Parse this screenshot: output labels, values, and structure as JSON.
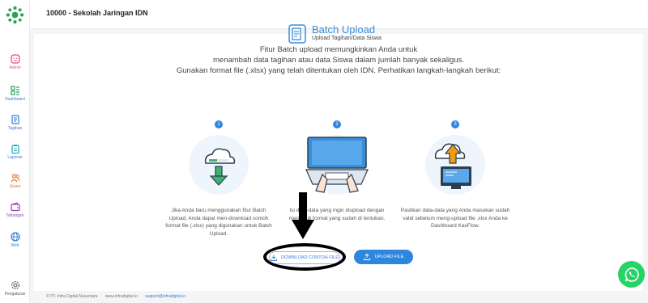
{
  "header": {
    "title": "10000 - Sekolah Jaringan IDN"
  },
  "sidebar": {
    "items": [
      {
        "label": "Admin",
        "icon": "admin-face-icon"
      },
      {
        "label": "Dashboard",
        "icon": "dashboard-icon"
      },
      {
        "label": "Tagihan",
        "icon": "bill-icon"
      },
      {
        "label": "Laporan",
        "icon": "report-clipboard-icon"
      },
      {
        "label": "Siswa",
        "icon": "students-icon"
      },
      {
        "label": "Tabungan",
        "icon": "wallet-icon"
      },
      {
        "label": "Web",
        "icon": "globe-icon"
      }
    ],
    "settings_label": "Pengaturan"
  },
  "main": {
    "title": "Batch Upload",
    "subtitle": "Upload Tagihan/Data Siswa",
    "intro_line1": "Fitur Batch upload memungkinkan Anda untuk",
    "intro_line2": "menambah data tagihan atau data Siswa dalam jumlah banyak sekaligus.",
    "intro_line3": "Gunakan format file (.xlsx) yang telah ditentukan oleh IDN. Perhatikan langkah-langkah berikut:",
    "steps": [
      {
        "number": "1",
        "text": "Jika Anda baru menggunakan fitur Batch Upload, Anda dapat men-download contoh format file (.xlsx) yang digunakan untuk Batch Upload."
      },
      {
        "number": "2",
        "text": "Isi data-data yang ingin diupload dengan mengikuti format yang sudah di tentukan."
      },
      {
        "number": "3",
        "text": "Pastikan data-data yang Anda masukan sudah valid sebelum meng-upload file .xlsx Anda ke Dashboard KasFlow."
      }
    ],
    "download_label": "DOWNLOAD CONTOH FILE",
    "upload_label": "UPLOAD FILE"
  },
  "footer": {
    "copyright": "© PT. Infra Digital Nusantara",
    "website": "www.infradigital.io",
    "email": "support@infradigital.io"
  },
  "colors": {
    "accent": "#2e86de",
    "brand_green": "#2e9e5b",
    "whatsapp": "#25d366"
  }
}
